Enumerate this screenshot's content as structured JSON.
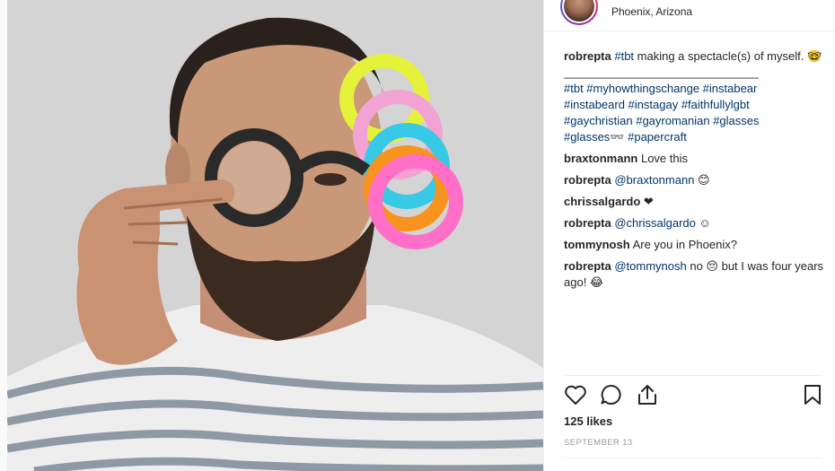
{
  "post": {
    "location": "Phoenix, Arizona",
    "caption": {
      "username": "robrepta",
      "hashtag_first": "#tbt",
      "text": " making a spectacle(s) of myself. 🤓",
      "separator": "______________________________",
      "hashtags_line1": "#tbt #myhowthingschange #instabear",
      "hashtags_line2": "#instabeard #instagay #faithfullylgbt",
      "hashtags_line3": "#gaychristian #gayromanian #glasses",
      "hashtags_line4": "#glasses👓 #papercraft"
    },
    "comments": [
      {
        "username": "braxtonmann",
        "mention": "",
        "text": "Love this"
      },
      {
        "username": "robrepta",
        "mention": "@braxtonmann",
        "text": " 😊"
      },
      {
        "username": "chrissalgardo",
        "mention": "",
        "text": "❤"
      },
      {
        "username": "robrepta",
        "mention": "@chrissalgardo",
        "text": " ☺"
      },
      {
        "username": "tommynosh",
        "mention": "",
        "text": "Are you in Phoenix?"
      },
      {
        "username": "robrepta",
        "mention": "@tommynosh",
        "text": " no 😔 but I was four years ago! 😂"
      }
    ],
    "likes": "125 likes",
    "date": "SEPTEMBER 13"
  },
  "icons": {
    "like": "heart-outline-icon",
    "comment": "speech-bubble-icon",
    "share": "share-upload-icon",
    "save": "bookmark-icon"
  }
}
